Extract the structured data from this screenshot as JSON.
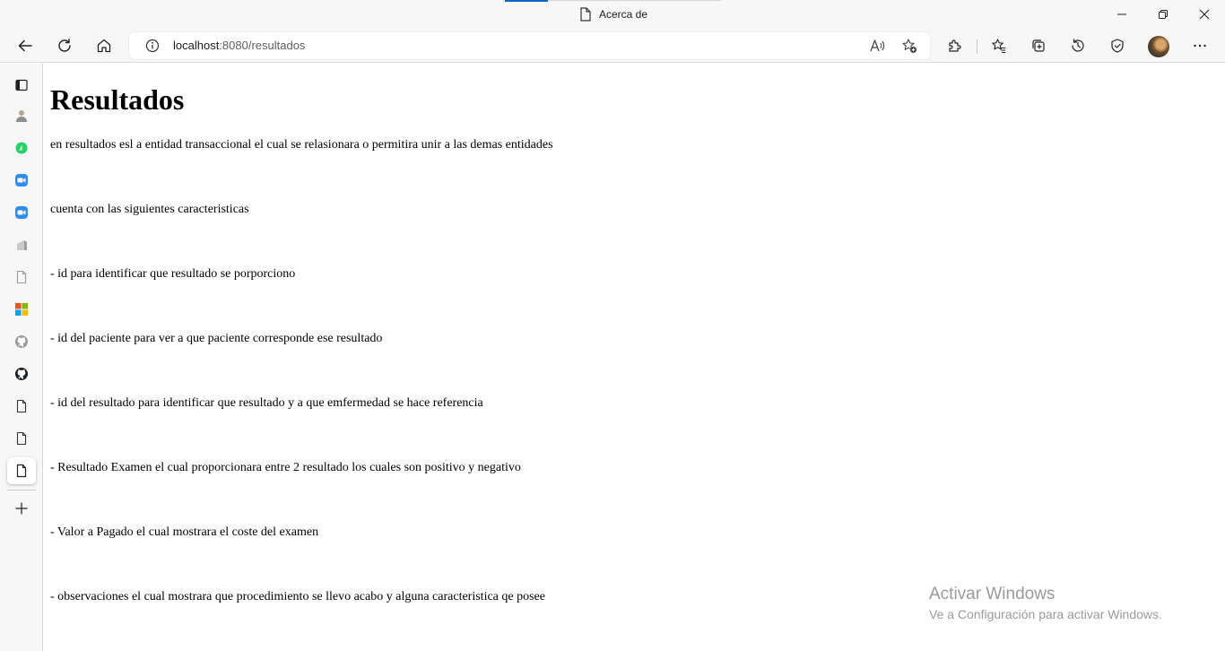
{
  "window": {
    "tab_title": "Acerca de"
  },
  "toolbar": {
    "address": {
      "host": "localhost",
      "path": ":8080/resultados"
    }
  },
  "icons": {
    "title": [
      "file-icon",
      "minimize-icon",
      "restore-icon",
      "close-icon"
    ],
    "toolbar": [
      "back-icon",
      "refresh-icon",
      "home-icon",
      "info-icon",
      "read-aloud-icon",
      "add-favorite-icon",
      "extensions-icon",
      "favorites-icon",
      "collections-icon",
      "history-icon",
      "browser-essentials-icon",
      "profile-avatar",
      "more-icon"
    ],
    "sidebar": [
      "tab-actions-icon",
      "tab-favicon-person",
      "tab-favicon-whatsapp",
      "tab-favicon-zoom",
      "tab-favicon-zoom",
      "tab-favicon-app",
      "tab-favicon-file",
      "tab-favicon-microsoft",
      "tab-favicon-github",
      "tab-favicon-github",
      "tab-favicon-file",
      "tab-favicon-file",
      "tab-favicon-file-active",
      "new-tab-icon"
    ]
  },
  "colors": {
    "accent": "#0a66c2",
    "chrome_bg": "#f7f7f7",
    "whatsapp": "#25d366",
    "zoom": "#2d8cff"
  },
  "page": {
    "heading": "Resultados",
    "paragraphs": [
      "en resultados esl a entidad transaccional el cual se relasionara o permitira unir a las demas entidades",
      "cuenta con las siguientes caracteristicas",
      "- id para identificar que resultado se porporciono",
      "- id del paciente para ver a que paciente corresponde ese resultado",
      "- id del resultado para identificar que resultado y a que emfermedad se hace referencia",
      "- Resultado Examen el cual proporcionara entre 2 resultado los cuales son positivo y negativo",
      "- Valor a Pagado el cual mostrara el coste del examen",
      "- observaciones el cual mostrara que procedimiento se llevo acabo y alguna caracteristica qe posee"
    ]
  },
  "watermark": {
    "title": "Activar Windows",
    "subtitle": "Ve a Configuración para activar Windows."
  }
}
